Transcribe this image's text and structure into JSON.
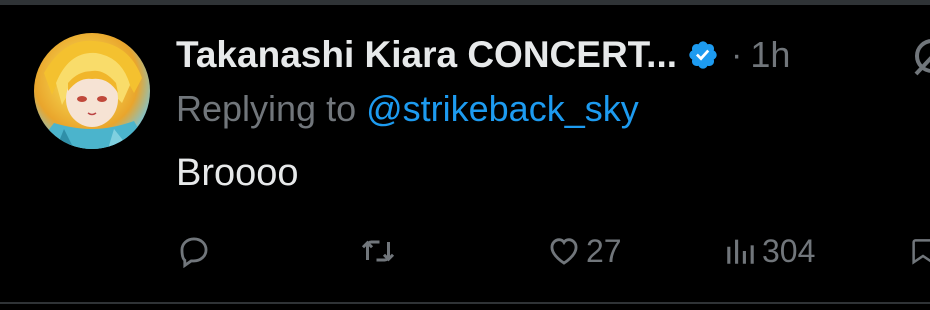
{
  "tweet": {
    "author_name": "Takanashi Kiara CONCERT...",
    "verified": true,
    "separator": "·",
    "timestamp": "1h",
    "replying_prefix": "Replying to ",
    "replying_handle": "@strikeback_sky",
    "text": "Broooo"
  },
  "actions": {
    "reply_icon": "reply-icon",
    "retweet_icon": "retweet-icon",
    "like_icon": "heart-icon",
    "likes_count": "27",
    "views_icon": "views-icon",
    "views_count": "304",
    "bookmark_icon": "bookmark-icon",
    "grok_icon": "grok-icon"
  },
  "colors": {
    "background": "#000000",
    "primary_text": "#e7e9ea",
    "secondary_text": "#71767b",
    "link": "#1d9bf0",
    "verified_badge": "#1d9bf0",
    "divider": "#2f3336"
  }
}
